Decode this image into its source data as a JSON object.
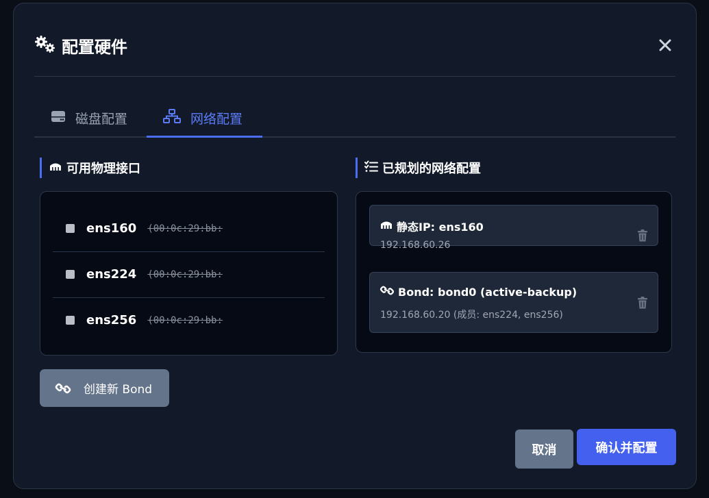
{
  "dialog": {
    "title": "配置硬件",
    "icon": "gears-icon",
    "close_icon": "close-icon"
  },
  "tabs": [
    {
      "label": "磁盘配置",
      "icon": "hdd-icon",
      "active": false
    },
    {
      "label": "网络配置",
      "icon": "network-icon",
      "active": true
    }
  ],
  "interfaces_section": {
    "title": "可用物理接口",
    "icon": "ethernet-icon",
    "items": [
      {
        "name": "ens160",
        "mac": "(00:0c:29:bb:",
        "checked": false
      },
      {
        "name": "ens224",
        "mac": "(00:0c:29:bb:",
        "checked": false
      },
      {
        "name": "ens256",
        "mac": "(00:0c:29:bb:",
        "checked": false
      }
    ]
  },
  "create_bond_label": "创建新 Bond",
  "planned_section": {
    "title": "已规划的网络配置",
    "icon": "list-check-icon",
    "items": [
      {
        "title": "静态IP: ens160",
        "detail": "192.168.60.26",
        "icon": "ethernet-icon"
      },
      {
        "title": "Bond: bond0 (active-backup)",
        "detail": "192.168.60.20 (成员: ens224, ens256)",
        "icon": "link-icon"
      }
    ]
  },
  "footer": {
    "cancel_label": "取消",
    "confirm_label": "确认并配置"
  },
  "colors": {
    "accent": "#4c6ef5",
    "modal_bg": "#121a2a",
    "panel_bg": "#050a14",
    "card_bg": "#1f2838",
    "secondary_button": "#64748b",
    "primary_button": "#4361ee"
  }
}
